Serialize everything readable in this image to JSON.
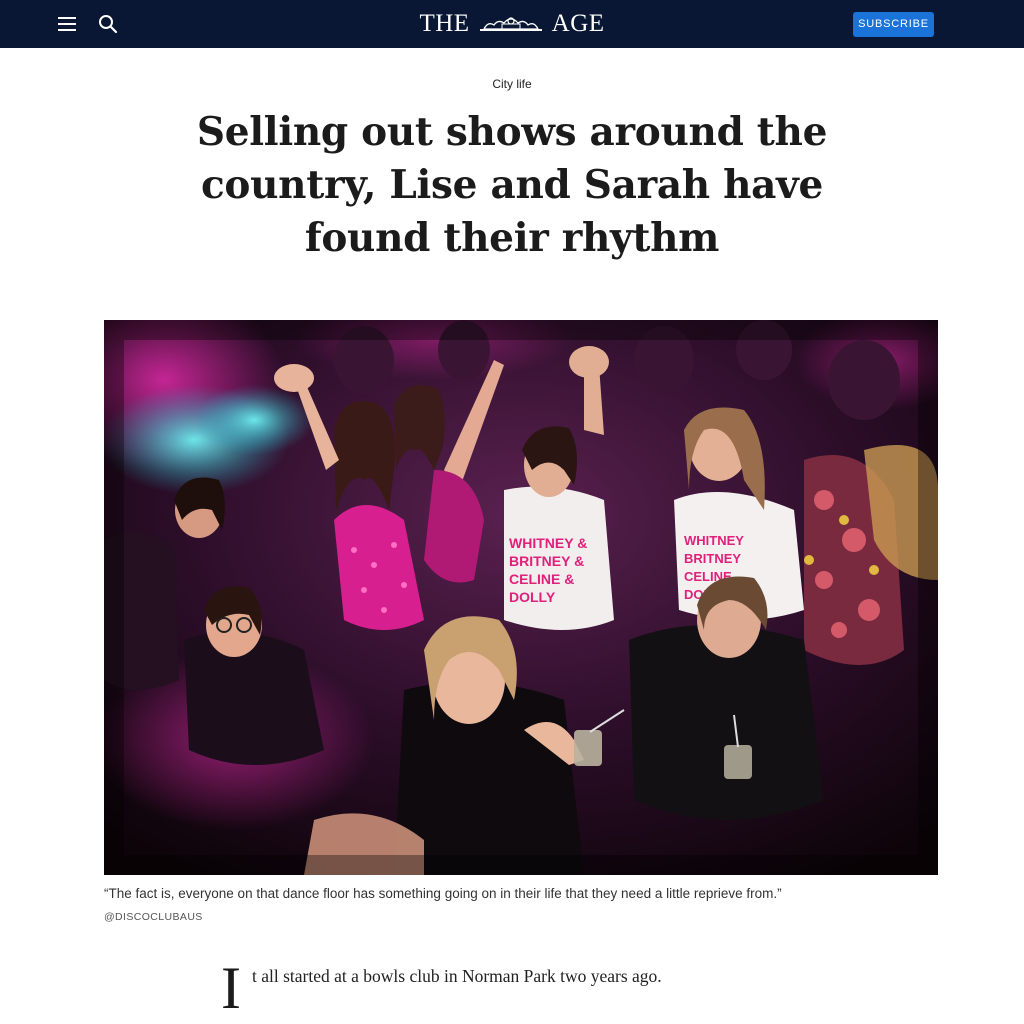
{
  "header": {
    "masthead_left": "THE",
    "masthead_right": "AGE",
    "subscribe_label": "SUBSCRIBE",
    "icons": {
      "menu": "hamburger-menu-icon",
      "search": "search-icon",
      "crest": "crest-icon"
    },
    "colors": {
      "bar": "#0a1734",
      "subscribe": "#1a73d9"
    }
  },
  "article": {
    "kicker": "City life",
    "headline": "Selling out shows around the country, Lise and Sarah have found their rhythm",
    "caption": "“The fact is, everyone on that dance floor has something going on in their life that they need a little reprieve from.”",
    "credit": "@DISCOCLUBAUS",
    "dropcap": "I",
    "lede": "t all started at a bowls club in Norman Park two years ago."
  },
  "hero": {
    "shirt_text": [
      "WHITNEY &",
      "BRITNEY &",
      "CELINE &",
      "DOLLY"
    ]
  }
}
